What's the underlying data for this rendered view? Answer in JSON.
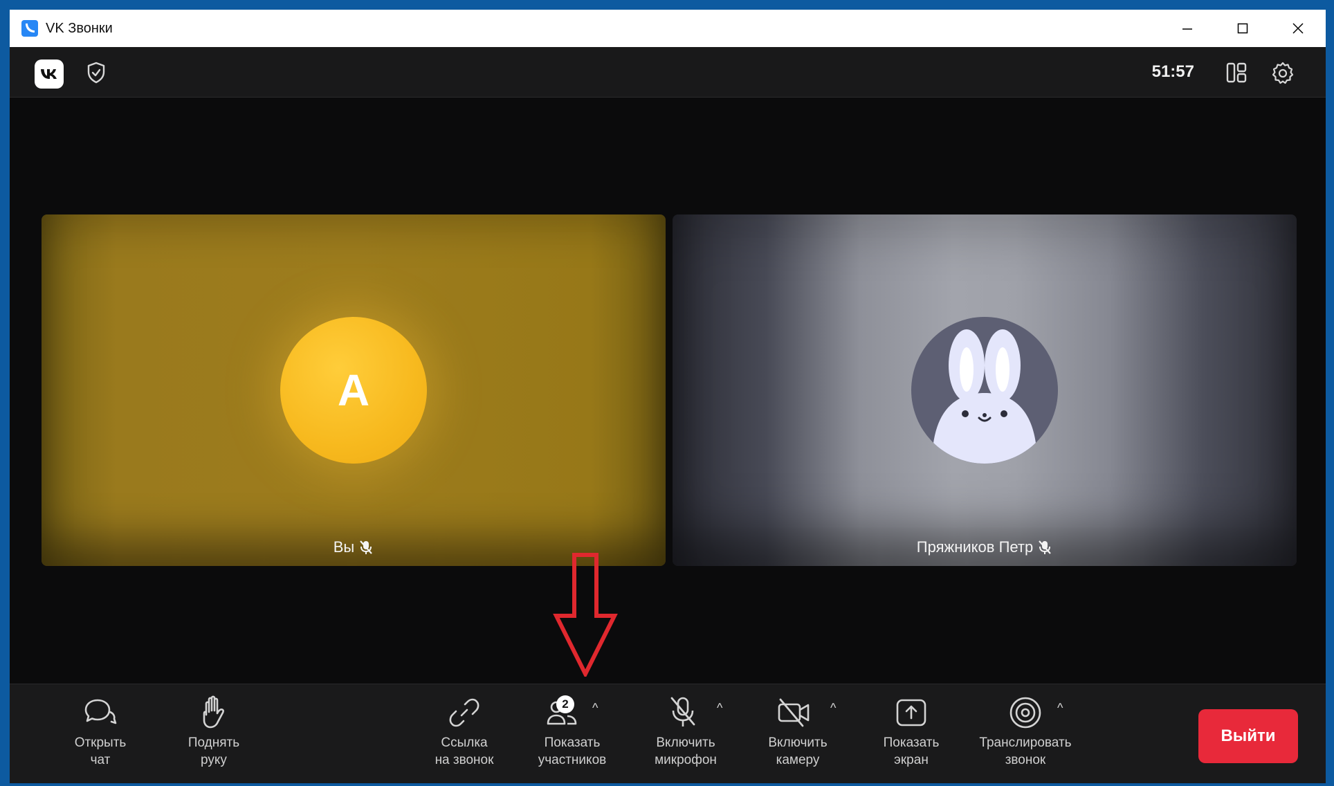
{
  "window": {
    "title": "VK Звонки",
    "controls": [
      "minimize",
      "maximize",
      "close"
    ]
  },
  "header": {
    "timer": "51:57",
    "icons": [
      "vk-logo",
      "shield-check-icon",
      "layout-grid-icon",
      "gear-icon"
    ]
  },
  "tiles": [
    {
      "name": "Вы",
      "avatar_letter": "A",
      "muted": true,
      "color": "#f7b91e"
    },
    {
      "name": "Пряжников Петр",
      "avatar": "bunny",
      "muted": true
    }
  ],
  "toolbar": {
    "chat": {
      "label": "Открыть\nчат"
    },
    "hand": {
      "label": "Поднять\nруку"
    },
    "link": {
      "label": "Ссылка\nна звонок"
    },
    "participants": {
      "label": "Показать\nучастников",
      "count": "2"
    },
    "mic": {
      "label": "Включить\nмикрофон"
    },
    "camera": {
      "label": "Включить\nкамеру"
    },
    "screen": {
      "label": "Показать\nэкран"
    },
    "broadcast": {
      "label": "Транслировать\nзвонок"
    },
    "leave": {
      "label": "Выйти"
    }
  },
  "colors": {
    "accent_red": "#e8293a",
    "annotation_arrow": "#e0282e",
    "toolbar_bg": "#1a1a1b"
  }
}
